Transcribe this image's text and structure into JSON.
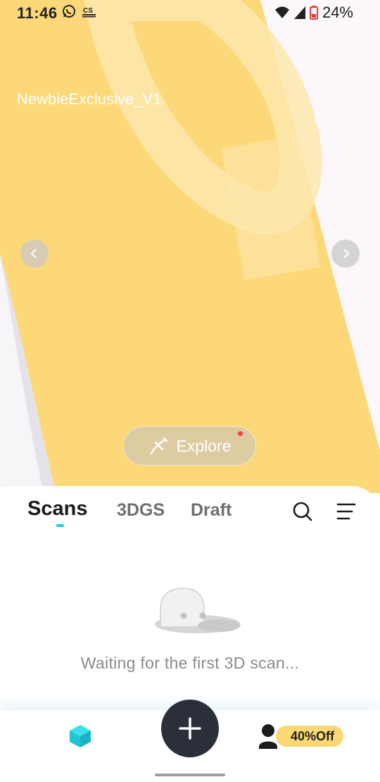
{
  "status_bar": {
    "time": "11:46",
    "battery_text": "24%",
    "icons": [
      "whatsapp-icon",
      "cs-icon",
      "wifi-icon",
      "signal-icon",
      "battery-icon"
    ]
  },
  "banner": {
    "title": "NewbieExclusive_V1",
    "explore_label": "Explore",
    "colors": {
      "background": "#fdd878",
      "accent_dot": "#ff3d3d"
    }
  },
  "tabs": {
    "items": [
      {
        "label": "Scans",
        "active": true
      },
      {
        "label": "3DGS",
        "active": false
      },
      {
        "label": "Draft",
        "active": false
      }
    ],
    "indicator_color": "#19d3e0"
  },
  "empty_state": {
    "message": "Waiting for the first 3D scan..."
  },
  "bottom_nav": {
    "offer_label": "40%Off",
    "icons": [
      "cube-icon",
      "plus-icon",
      "profile-icon"
    ]
  }
}
